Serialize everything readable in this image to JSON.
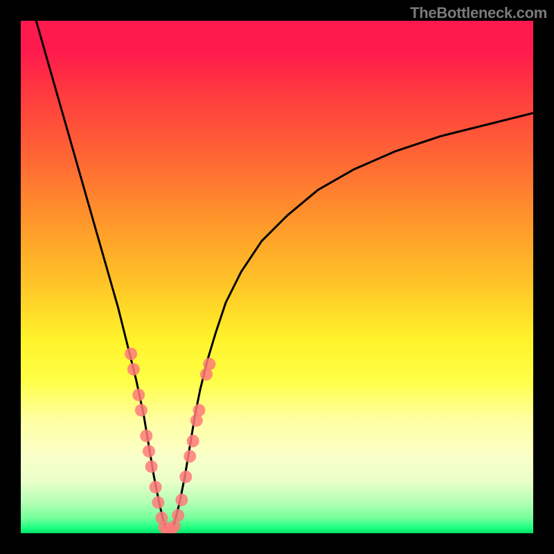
{
  "watermark": "TheBottleneck.com",
  "chart_data": {
    "type": "line",
    "title": "",
    "xlabel": "",
    "ylabel": "",
    "xlim": [
      0,
      100
    ],
    "ylim": [
      0,
      100
    ],
    "grid": false,
    "legend": false,
    "background_gradient": {
      "type": "vertical",
      "stops": [
        {
          "pos": 0,
          "color": "#ff1a4d"
        },
        {
          "pos": 0.28,
          "color": "#ff6b33"
        },
        {
          "pos": 0.52,
          "color": "#ffc727"
        },
        {
          "pos": 0.7,
          "color": "#ffff45"
        },
        {
          "pos": 0.9,
          "color": "#e8ffc8"
        },
        {
          "pos": 1.0,
          "color": "#00e066"
        }
      ]
    },
    "series": [
      {
        "name": "bottleneck-curve",
        "color": "#000000",
        "x": [
          3,
          5,
          7,
          9,
          11,
          13,
          15,
          17,
          19,
          21,
          22.5,
          24,
          25,
          26,
          27,
          27.8,
          28.5,
          29.2,
          30,
          31,
          32,
          33,
          34,
          35,
          36.5,
          38,
          40,
          43,
          47,
          52,
          58,
          65,
          73,
          82,
          92,
          100
        ],
        "y": [
          100,
          93,
          86,
          79,
          72,
          65,
          58,
          51,
          44,
          36,
          30,
          23,
          17,
          11,
          6,
          2.5,
          0.5,
          0.5,
          2,
          6,
          11,
          17,
          23,
          28,
          34,
          39,
          45,
          51,
          57,
          62,
          67,
          71,
          74.5,
          77.5,
          80,
          82
        ]
      }
    ],
    "scatter_points": {
      "name": "highlight-dots-left-and-right-of-minimum",
      "color": "#ff7a7a",
      "radius_px": 9,
      "points": [
        {
          "x": 21.5,
          "y": 35
        },
        {
          "x": 22.0,
          "y": 32
        },
        {
          "x": 23.0,
          "y": 27
        },
        {
          "x": 23.5,
          "y": 24
        },
        {
          "x": 24.5,
          "y": 19
        },
        {
          "x": 25.0,
          "y": 16
        },
        {
          "x": 25.5,
          "y": 13
        },
        {
          "x": 26.3,
          "y": 9
        },
        {
          "x": 26.8,
          "y": 6
        },
        {
          "x": 27.5,
          "y": 3
        },
        {
          "x": 28.0,
          "y": 1.2
        },
        {
          "x": 28.7,
          "y": 0.6
        },
        {
          "x": 29.3,
          "y": 0.6
        },
        {
          "x": 30.0,
          "y": 1.4
        },
        {
          "x": 30.7,
          "y": 3.5
        },
        {
          "x": 31.4,
          "y": 6.5
        },
        {
          "x": 32.2,
          "y": 11
        },
        {
          "x": 33.0,
          "y": 15
        },
        {
          "x": 33.6,
          "y": 18
        },
        {
          "x": 34.3,
          "y": 22
        },
        {
          "x": 34.8,
          "y": 24
        },
        {
          "x": 36.2,
          "y": 31
        },
        {
          "x": 36.8,
          "y": 33
        }
      ]
    }
  }
}
